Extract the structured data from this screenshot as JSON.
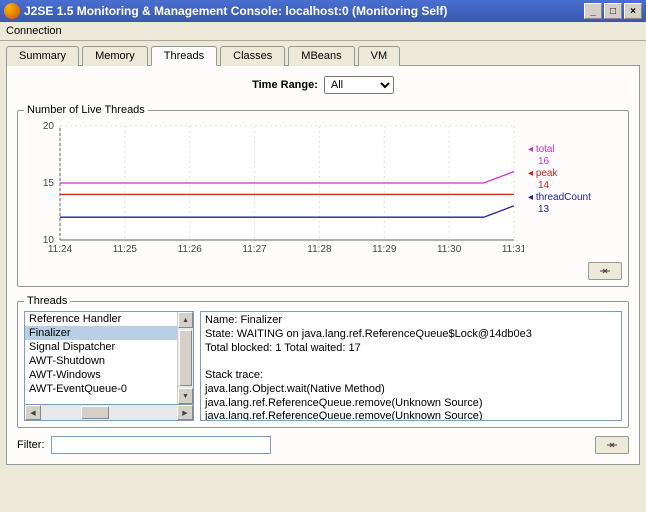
{
  "window": {
    "title": "J2SE 1.5 Monitoring & Management Console: localhost:0 (Monitoring Self)"
  },
  "menubar": {
    "connection": "Connection"
  },
  "tabs": {
    "summary": "Summary",
    "memory": "Memory",
    "threads": "Threads",
    "classes": "Classes",
    "mbeans": "MBeans",
    "vm": "VM"
  },
  "timerange": {
    "label": "Time Range:",
    "value": "All"
  },
  "chart": {
    "legend_title": "Number of Live Threads",
    "series_labels": {
      "total": "total",
      "peak": "peak",
      "threadcount": "threadCount"
    },
    "series_values": {
      "total": "16",
      "peak": "14",
      "threadcount": "13"
    }
  },
  "chart_data": {
    "type": "line",
    "title": "Number of Live Threads",
    "xlabel": "",
    "ylabel": "",
    "ylim": [
      10,
      20
    ],
    "y_ticks": [
      10,
      15,
      20
    ],
    "x_ticks": [
      "11:24",
      "11:25",
      "11:26",
      "11:27",
      "11:28",
      "11:29",
      "11:30",
      "11:31"
    ],
    "series": [
      {
        "name": "total",
        "color": "#d030d0",
        "current": 16,
        "values": [
          15,
          15,
          15,
          15,
          15,
          15,
          15,
          15,
          15,
          15,
          15,
          15,
          15,
          15,
          15,
          16
        ]
      },
      {
        "name": "peak",
        "color": "#d02020",
        "current": 14,
        "values": [
          14,
          14,
          14,
          14,
          14,
          14,
          14,
          14,
          14,
          14,
          14,
          14,
          14,
          14,
          14,
          14
        ]
      },
      {
        "name": "threadCount",
        "color": "#2020a0",
        "current": 13,
        "values": [
          12,
          12,
          12,
          12,
          12,
          12,
          12,
          12,
          12,
          12,
          12,
          12,
          12,
          12,
          12,
          13
        ]
      }
    ]
  },
  "threads_panel": {
    "legend": "Threads",
    "items": [
      "Reference Handler",
      "Finalizer",
      "Signal Dispatcher",
      "AWT-Shutdown",
      "AWT-Windows",
      "AWT-EventQueue-0"
    ],
    "selected_index": 1,
    "detail_lines": [
      "Name: Finalizer",
      "State: WAITING on java.lang.ref.ReferenceQueue$Lock@14db0e3",
      "Total blocked: 1  Total waited: 17",
      "",
      "Stack trace:",
      "java.lang.Object.wait(Native Method)",
      "java.lang.ref.ReferenceQueue.remove(Unknown Source)",
      "java.lang.ref.ReferenceQueue.remove(Unknown Source)"
    ]
  },
  "filter": {
    "label": "Filter:",
    "value": ""
  }
}
